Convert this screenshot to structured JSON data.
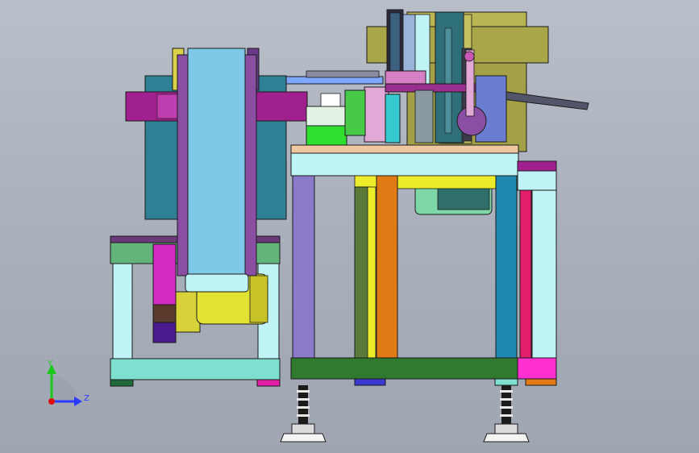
{
  "viewport": {
    "background_top": "#b9bfc9",
    "background_bottom": "#9fa6b2"
  },
  "triad": {
    "y_label": "Y",
    "z_label": "Z",
    "y_color": "#19c819",
    "z_color": "#2a3cff",
    "origin_color": "#e01010"
  },
  "palette": {
    "cyan_belt": "#7ec9e8",
    "purple_frame": "#8a4fa3",
    "magenta": "#a0208f",
    "steel_blue": "#2f7f95",
    "olive": "#a9a64a",
    "light_cyan": "#bff3f5",
    "green_plate": "#2f7a2f",
    "orange": "#e07a14",
    "yellow_motor": "#e2e234"
  }
}
